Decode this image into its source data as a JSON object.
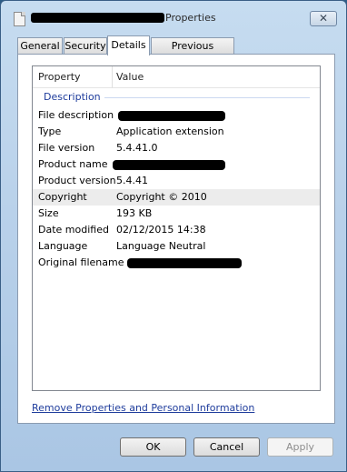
{
  "window": {
    "title": "Properties",
    "close_symbol": "✕"
  },
  "tabs": [
    {
      "label": "General"
    },
    {
      "label": "Security"
    },
    {
      "label": "Details",
      "active": true
    },
    {
      "label": "Previous Versions"
    }
  ],
  "details": {
    "columns": {
      "property": "Property",
      "value": "Value"
    },
    "group_label": "Description",
    "rows": [
      {
        "property": "File description",
        "value": ""
      },
      {
        "property": "Type",
        "value": "Application extension"
      },
      {
        "property": "File version",
        "value": "5.4.41.0"
      },
      {
        "property": "Product name",
        "value": ""
      },
      {
        "property": "Product version",
        "value": "5.4.41"
      },
      {
        "property": "Copyright",
        "value": "Copyright ©  2010"
      },
      {
        "property": "Size",
        "value": "193 KB"
      },
      {
        "property": "Date modified",
        "value": "02/12/2015 14:38"
      },
      {
        "property": "Language",
        "value": "Language Neutral"
      },
      {
        "property": "Original filename",
        "value": ""
      }
    ]
  },
  "remove_link": "Remove Properties and Personal Information",
  "buttons": {
    "ok": "OK",
    "cancel": "Cancel",
    "apply": "Apply"
  }
}
